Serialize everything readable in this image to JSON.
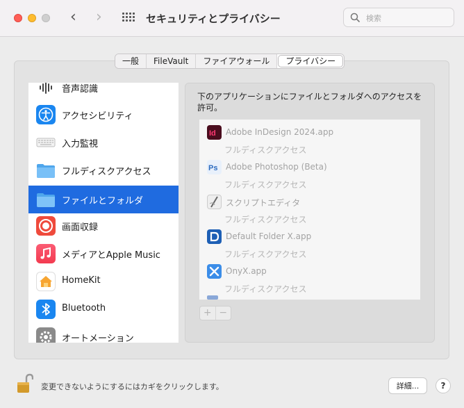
{
  "window": {
    "title": "セキュリティとプライバシー",
    "search_placeholder": "検索"
  },
  "tabs": [
    {
      "label": "一般",
      "active": false
    },
    {
      "label": "FileVault",
      "active": false
    },
    {
      "label": "ファイアウォール",
      "active": false
    },
    {
      "label": "プライバシー",
      "active": true
    }
  ],
  "categories": [
    {
      "label": "音声認識",
      "icon": "waveform-icon"
    },
    {
      "label": "アクセシビリティ",
      "icon": "accessibility-icon"
    },
    {
      "label": "入力監視",
      "icon": "keyboard-icon"
    },
    {
      "label": "フルディスクアクセス",
      "icon": "folder-icon"
    },
    {
      "label": "ファイルとフォルダ",
      "icon": "folder-icon",
      "selected": true
    },
    {
      "label": "画面収録",
      "icon": "screen-record-icon"
    },
    {
      "label": "メディアとApple Music",
      "icon": "music-icon"
    },
    {
      "label": "HomeKit",
      "icon": "home-icon"
    },
    {
      "label": "Bluetooth",
      "icon": "bluetooth-icon"
    },
    {
      "label": "オートメーション",
      "icon": "gear-icon"
    }
  ],
  "detail": {
    "description": "下のアプリケーションにファイルとフォルダへのアクセスを許可。",
    "apps": [
      {
        "name": "Adobe InDesign 2024.app",
        "sub": "フルディスクアクセス",
        "icon": "indesign-icon"
      },
      {
        "name": "Adobe Photoshop (Beta)",
        "sub": "フルディスクアクセス",
        "icon": "photoshop-icon"
      },
      {
        "name": "スクリプトエディタ",
        "sub": "フルディスクアクセス",
        "icon": "script-editor-icon"
      },
      {
        "name": "Default Folder X.app",
        "sub": "フルディスクアクセス",
        "icon": "default-folder-icon"
      },
      {
        "name": "OnyX.app",
        "sub": "フルディスクアクセス",
        "icon": "onyx-icon"
      }
    ],
    "add_label": "+",
    "remove_label": "−"
  },
  "footer": {
    "lock_text": "変更できないようにするにはカギをクリックします。",
    "details_label": "詳細...",
    "help_label": "?"
  },
  "colors": {
    "accent": "#1f6be0",
    "close": "#ff5f57",
    "minimize": "#febc2e"
  }
}
